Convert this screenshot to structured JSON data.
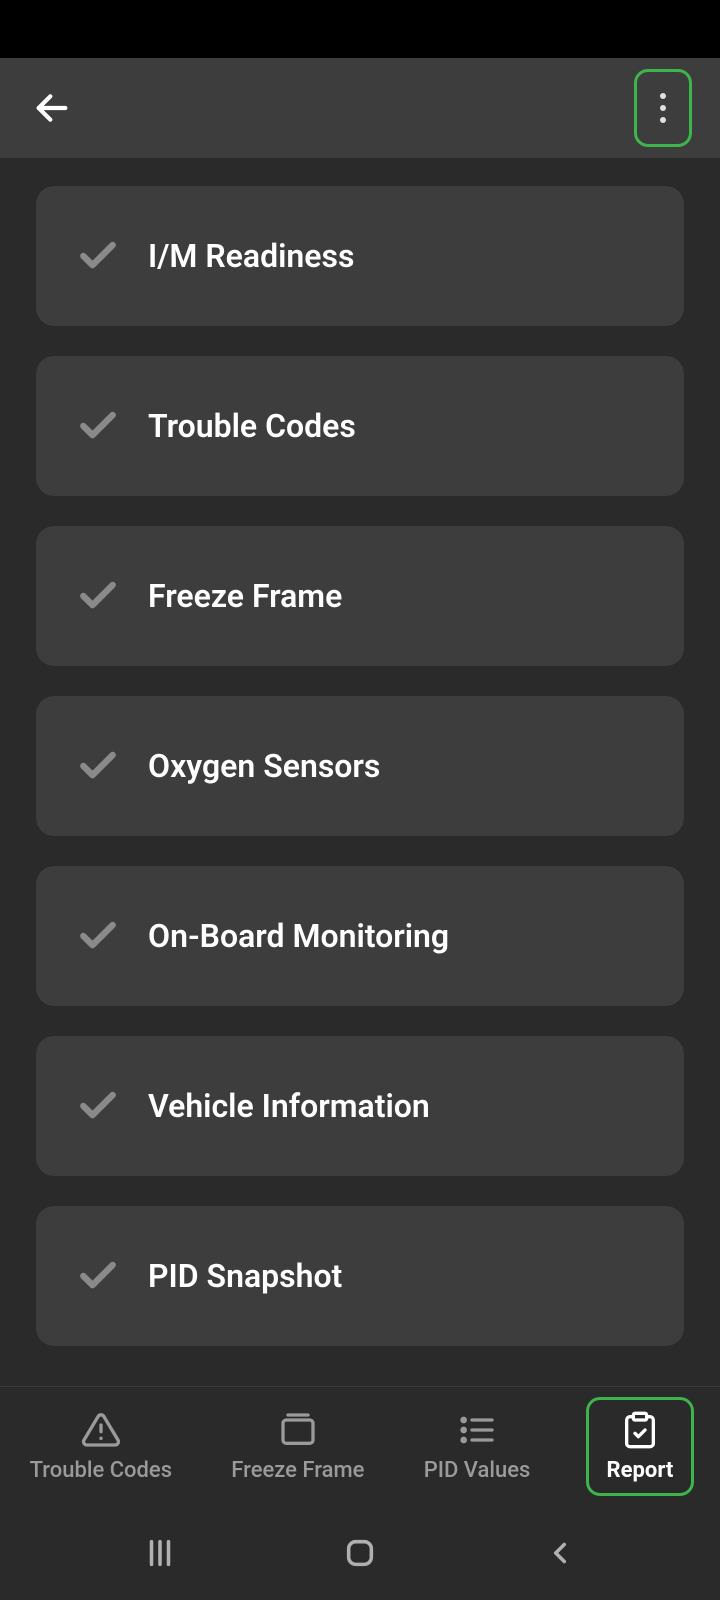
{
  "colors": {
    "accent": "#3eb54a",
    "background": "#2a2a2a",
    "card": "#3d3d3d",
    "text": "#ffffff",
    "muted": "#9a9a9a",
    "check": "#8a8a8a"
  },
  "reportItems": [
    {
      "label": "I/M Readiness",
      "checked": true
    },
    {
      "label": "Trouble Codes",
      "checked": true
    },
    {
      "label": "Freeze Frame",
      "checked": true
    },
    {
      "label": "Oxygen Sensors",
      "checked": true
    },
    {
      "label": "On-Board Monitoring",
      "checked": true
    },
    {
      "label": "Vehicle Information",
      "checked": true
    },
    {
      "label": "PID Snapshot",
      "checked": true
    }
  ],
  "bottomNav": [
    {
      "label": "Trouble Codes",
      "icon": "warning-icon",
      "active": false
    },
    {
      "label": "Freeze Frame",
      "icon": "folder-icon",
      "active": false
    },
    {
      "label": "PID Values",
      "icon": "list-icon",
      "active": false
    },
    {
      "label": "Report",
      "icon": "clipboard-icon",
      "active": true
    }
  ]
}
